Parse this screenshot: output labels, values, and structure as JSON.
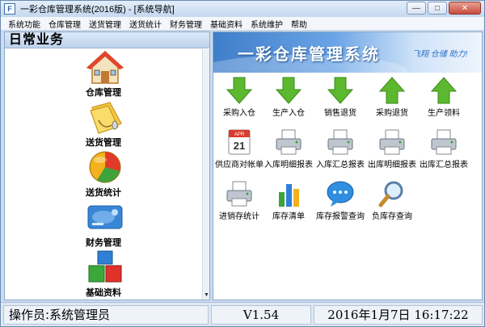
{
  "window": {
    "title": "一彩仓库管理系统(2016版) - [系统导航]",
    "icon": "app-icon",
    "controls": [
      "minimize",
      "maximize",
      "close"
    ]
  },
  "menu": [
    "系统功能",
    "仓库管理",
    "送货管理",
    "送货统计",
    "财务管理",
    "基础资料",
    "系统维护",
    "帮助"
  ],
  "left": {
    "header": "日常业务",
    "items": [
      {
        "label": "仓库管理",
        "icon": "warehouse-house-icon"
      },
      {
        "label": "送货管理",
        "icon": "delivery-folder-icon"
      },
      {
        "label": "送货统计",
        "icon": "pie-chart-icon"
      },
      {
        "label": "财务管理",
        "icon": "finance-card-icon"
      },
      {
        "label": "基础资料",
        "icon": "blocks-icon"
      }
    ]
  },
  "banner": {
    "title": "一彩仓库管理系统",
    "slogan": "飞翔 仓储 助力!"
  },
  "tools": [
    {
      "label": "采购入仓",
      "icon": "green-down-arrow-icon"
    },
    {
      "label": "生产入仓",
      "icon": "green-down-arrow-icon"
    },
    {
      "label": "销售退货",
      "icon": "green-down-arrow-icon"
    },
    {
      "label": "采购退货",
      "icon": "green-up-arrow-icon"
    },
    {
      "label": "生产领料",
      "icon": "green-up-arrow-icon"
    },
    {
      "label": "供应商对帐单",
      "icon": "calendar-icon",
      "cal_month": "APR",
      "cal_day": "21"
    },
    {
      "label": "入库明细报表",
      "icon": "printer-icon"
    },
    {
      "label": "入库汇总报表",
      "icon": "printer-icon"
    },
    {
      "label": "出库明细报表",
      "icon": "printer-icon"
    },
    {
      "label": "出库汇总报表",
      "icon": "printer-icon"
    },
    {
      "label": "进销存统计",
      "icon": "printer-icon"
    },
    {
      "label": "库存清单",
      "icon": "bar-chart-icon"
    },
    {
      "label": "库存报警查询",
      "icon": "speech-bubble-icon"
    },
    {
      "label": "负库存查询",
      "icon": "magnifier-icon"
    }
  ],
  "status": {
    "operator": "操作员:系统管理员",
    "version": "V1.54",
    "datetime": "2016年1月7日  16:17:22"
  },
  "colors": {
    "titlebar": "#c5d8f0",
    "banner": "#3f7ec9",
    "arrow_green": "#5cb82e",
    "status_bg": "#dfe8f3"
  }
}
